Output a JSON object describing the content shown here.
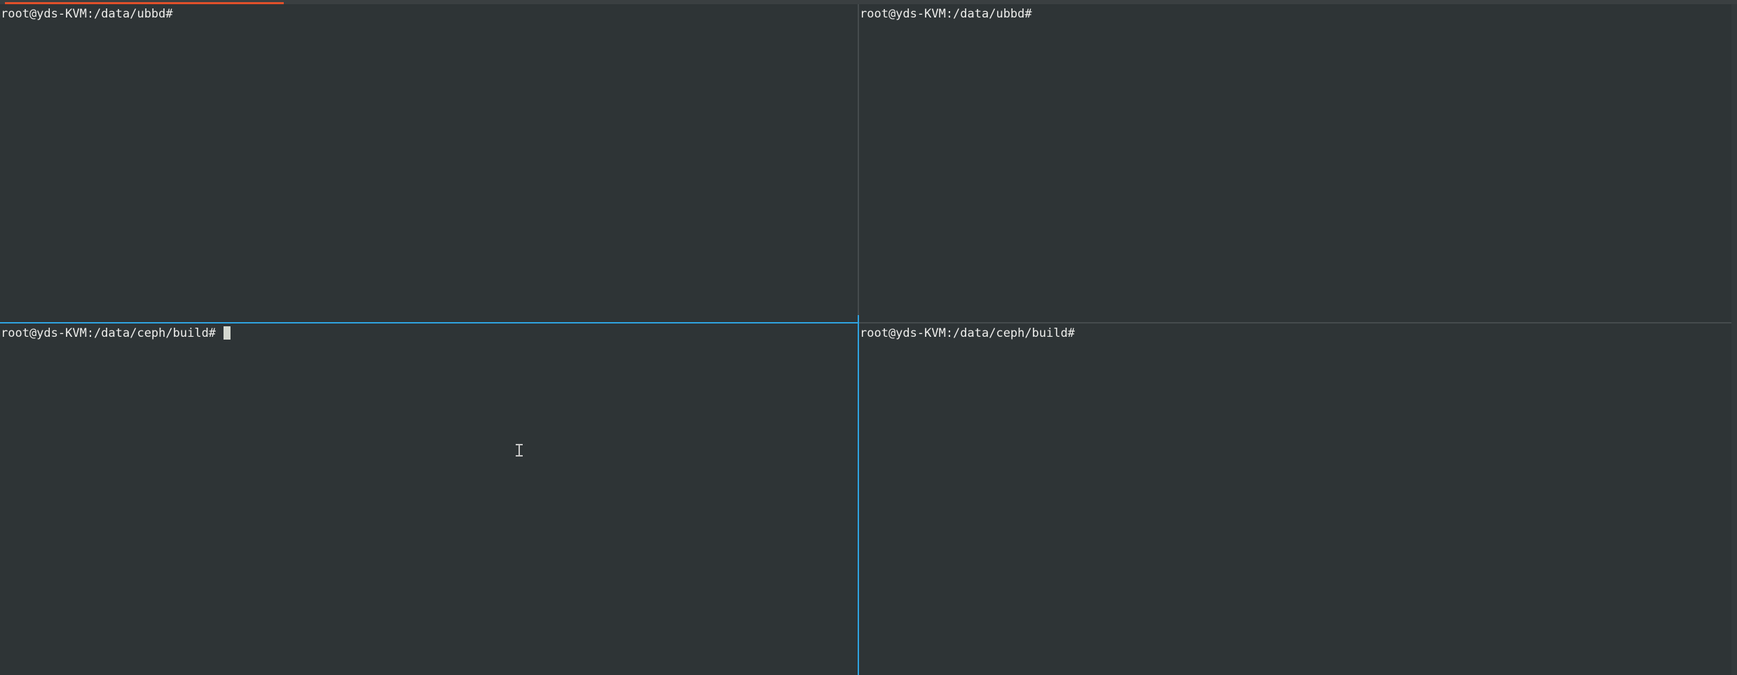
{
  "terminal": {
    "tab": {
      "active_indicator_color": "#e0502a"
    },
    "active_pane_border_color": "#2fa3e0",
    "panes": {
      "top_left": {
        "prompt": "root@yds-KVM:/data/ubbd#"
      },
      "top_right": {
        "prompt": "root@yds-KVM:/data/ubbd#"
      },
      "bottom_left": {
        "prompt": "root@yds-KVM:/data/ceph/build# ",
        "focused": true,
        "cursor_visible": true
      },
      "bottom_right": {
        "prompt": "root@yds-KVM:/data/ceph/build#"
      }
    },
    "mouse_pointer": "text-ibeam-cursor-icon"
  }
}
